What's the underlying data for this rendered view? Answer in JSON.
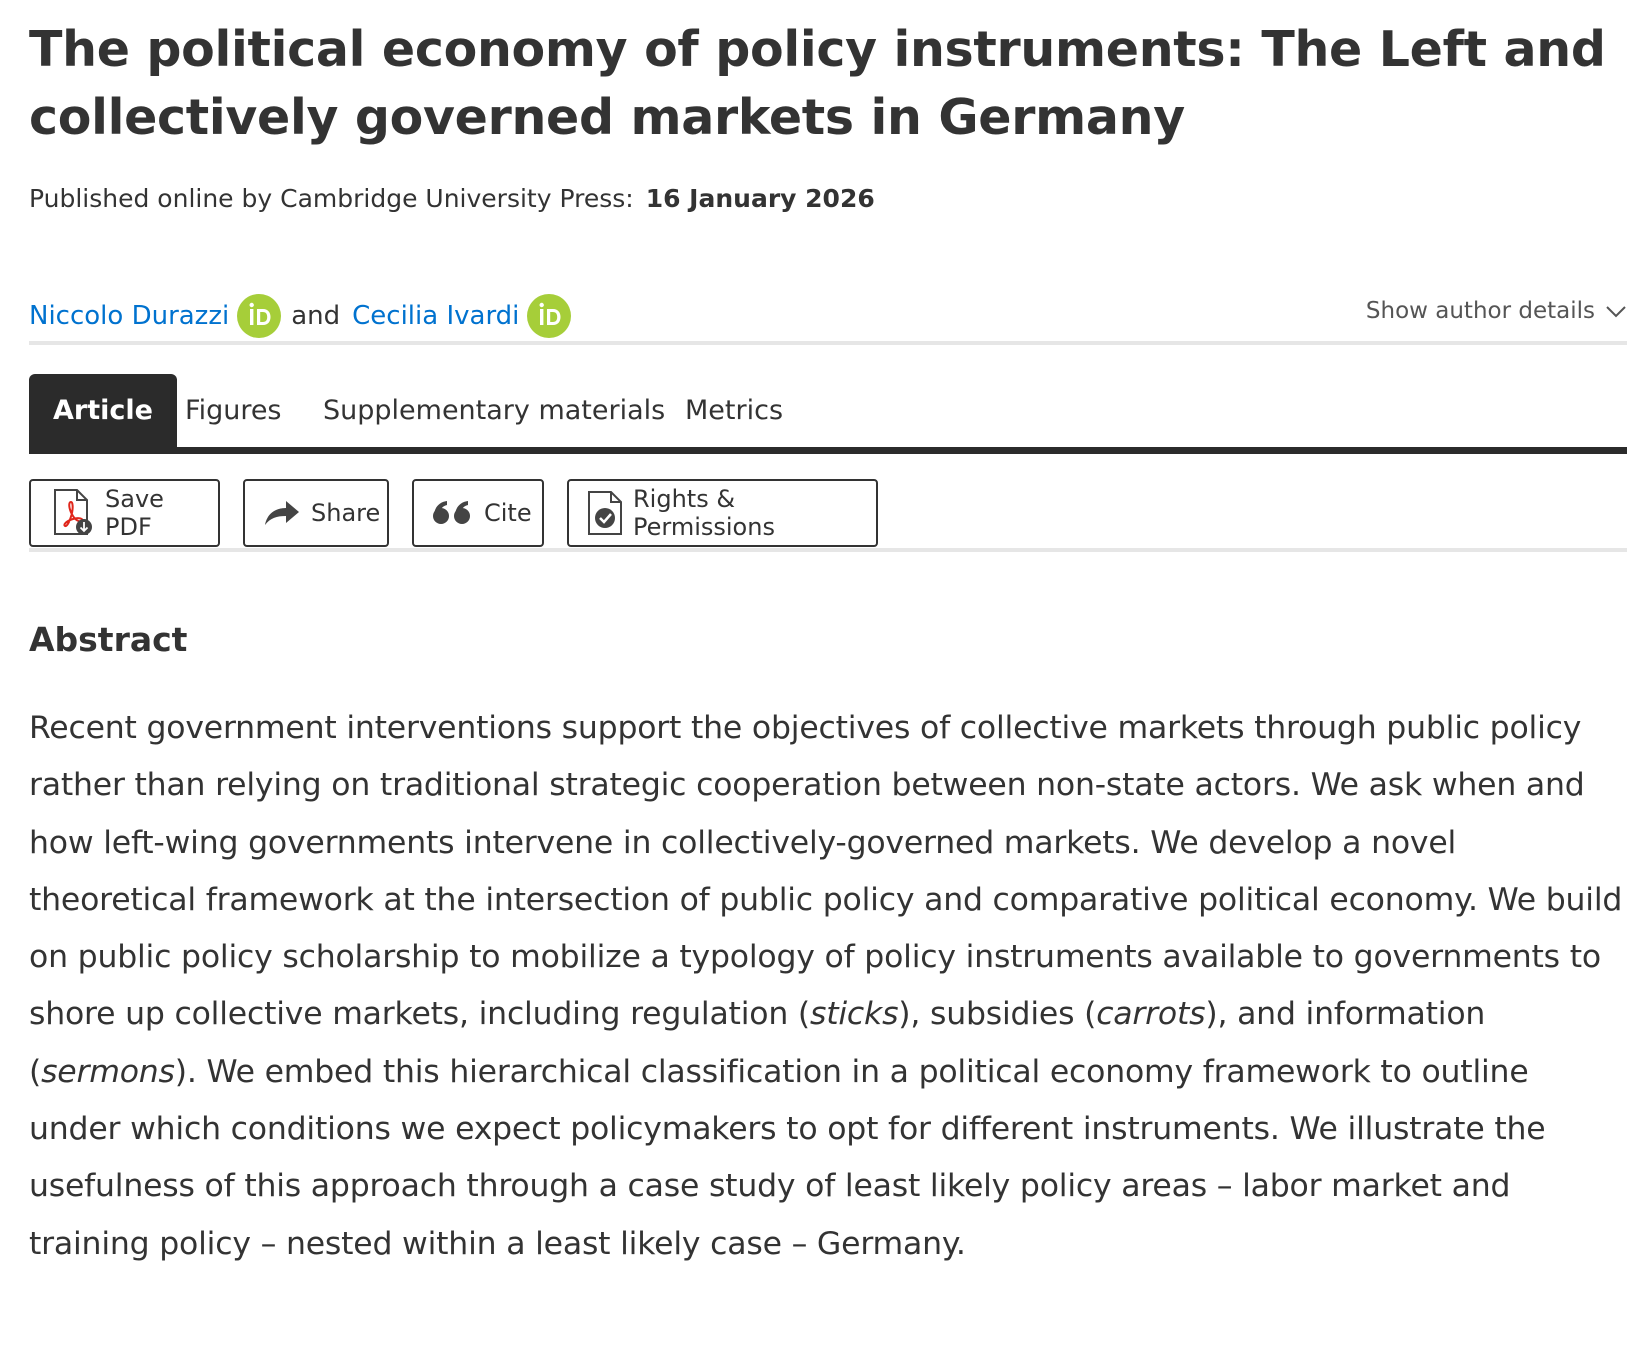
{
  "article": {
    "title": "The political economy of policy instruments: The Left and collectively governed markets in Germany",
    "published_label": "Published online by Cambridge University Press:",
    "published_date": "16 January 2026"
  },
  "authors": {
    "items": [
      {
        "name": "Niccolo Durazzi",
        "orcid_icon": "orcid-icon"
      },
      {
        "name": "Cecilia Ivardi",
        "orcid_icon": "orcid-icon"
      }
    ],
    "conjunction": "and",
    "show_details_label": "Show author details"
  },
  "tabs": {
    "items": [
      {
        "label": "Article",
        "active": true
      },
      {
        "label": "Figures",
        "active": false
      },
      {
        "label": "Supplementary materials",
        "active": false
      },
      {
        "label": "Metrics",
        "active": false
      }
    ]
  },
  "actions": {
    "save_pdf": "Save PDF",
    "share": "Share",
    "cite": "Cite",
    "rights": "Rights & Permissions"
  },
  "abstract": {
    "heading": "Abstract",
    "text_1": "Recent government interventions support the objectives of collective markets through public policy rather than relying on traditional strategic cooperation between non-state actors. We ask when and how left-wing governments intervene in collectively-governed markets. We develop a novel theoretical framework at the intersection of public policy and comparative political economy. We build on public policy scholarship to mobilize a typology of policy instruments available to governments to shore up collective markets, including regulation (",
    "em_1": "sticks",
    "text_2": "), subsidies (",
    "em_2": "carrots",
    "text_3": "), and information (",
    "em_3": "sermons",
    "text_4": "). We embed this hierarchical classification in a political economy framework to outline under which conditions we expect policymakers to opt for different instruments. We illustrate the usefulness of this approach through a case study of least likely policy areas – labor market and training policy – nested within a least likely case – Germany."
  },
  "colors": {
    "link": "#0072cf",
    "orcid": "#a6ce39",
    "tab_active_bg": "#2b2b2b",
    "text": "#333333",
    "pdf_red": "#e0261b"
  }
}
